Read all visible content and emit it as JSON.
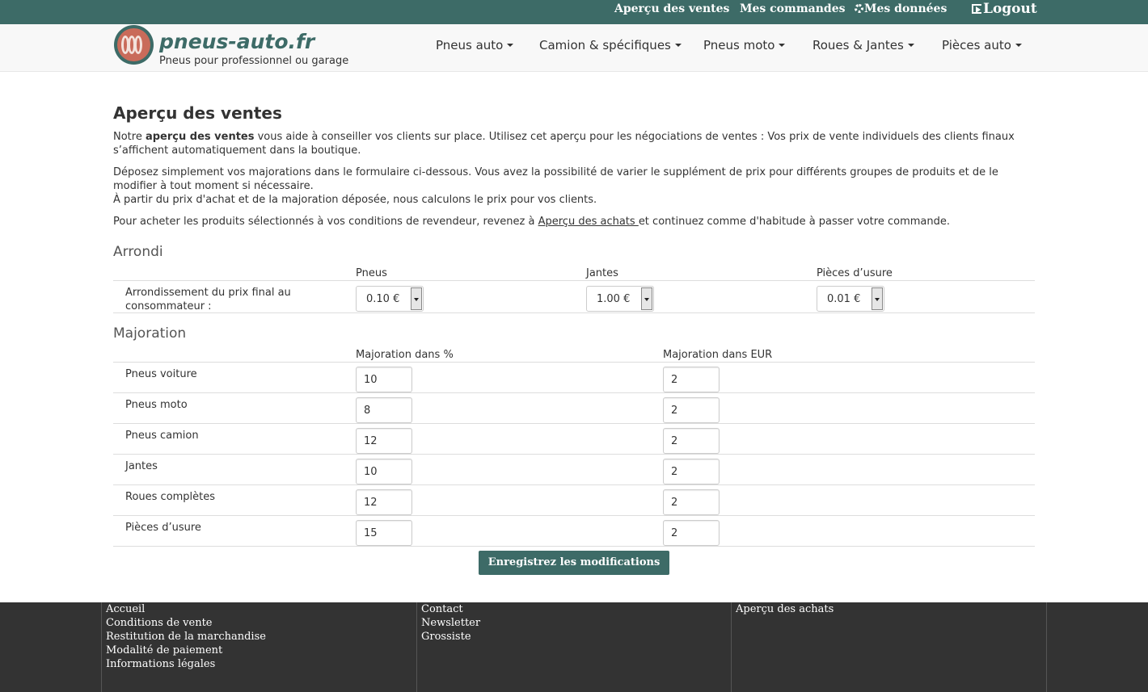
{
  "topbar": {
    "sales_overview": "Aperçu des ventes",
    "my_orders": "Mes commandes",
    "my_data": "Mes données",
    "logout": "Logout"
  },
  "header": {
    "brand": "pneus-auto.fr",
    "tagline": "Pneus pour professionnel ou garage",
    "nav": [
      "Pneus auto",
      "Camion & spécifiques",
      "Pneus moto",
      "Roues & Jantes",
      "Pièces auto"
    ]
  },
  "main": {
    "title": "Aperçu des ventes",
    "intro_prefix": "Notre ",
    "intro_bold": "aperçu des ventes",
    "intro_rest": " vous aide à conseiller vos clients sur place. Utilisez cet aperçu pour les négociations de ventes : Vos prix de vente individuels des clients finaux s’affichent automatiquement dans la boutique.",
    "para2_line1": "Déposez simplement vos majorations dans le formulaire ci-dessous. Vous avez la possibilité de varier le supplément de prix pour différents groupes de produits et de le modifier à tout moment si nécessaire.",
    "para2_line2": "À partir du prix d'achat et de la majoration déposée, nous calculons le prix pour vos clients.",
    "para3_prefix": "Pour acheter les produits sélectionnés à vos conditions de revendeur, revenez à ",
    "para3_link": "Aperçu des achats ",
    "para3_suffix": "et continuez comme d'habitude à passer votre commande."
  },
  "rounding": {
    "title": "Arrondi",
    "col_tyres": "Pneus",
    "col_rims": "Jantes",
    "col_wear": "Pièces d’usure",
    "row_label": "Arrondissement du prix final au consommateur :",
    "tyres_value": "0.10 €",
    "rims_value": "1.00 €",
    "wear_value": "0.01 €"
  },
  "markup": {
    "title": "Majoration",
    "col_percent": "Majoration dans %",
    "col_eur": "Majoration dans EUR",
    "rows": [
      {
        "label": "Pneus voiture",
        "percent": "10",
        "eur": "2"
      },
      {
        "label": "Pneus moto",
        "percent": "8",
        "eur": "2"
      },
      {
        "label": "Pneus camion",
        "percent": "12",
        "eur": "2"
      },
      {
        "label": "Jantes",
        "percent": "10",
        "eur": "2"
      },
      {
        "label": "Roues complètes",
        "percent": "12",
        "eur": "2"
      },
      {
        "label": "Pièces d’usure",
        "percent": "15",
        "eur": "2"
      }
    ],
    "save_label": "Enregistrez les modifications"
  },
  "footer": {
    "col1": [
      "Accueil",
      "Conditions de vente",
      "Restitution de la marchandise",
      "Modalité de paiement",
      "Informations légales"
    ],
    "col2": [
      "Contact",
      "Newsletter",
      "Grossiste"
    ],
    "col3": [
      "Aperçu des achats"
    ]
  },
  "colors": {
    "brand": "#3d6b67",
    "footer_bg": "#333333",
    "logo_accent": "#c96b5a"
  }
}
